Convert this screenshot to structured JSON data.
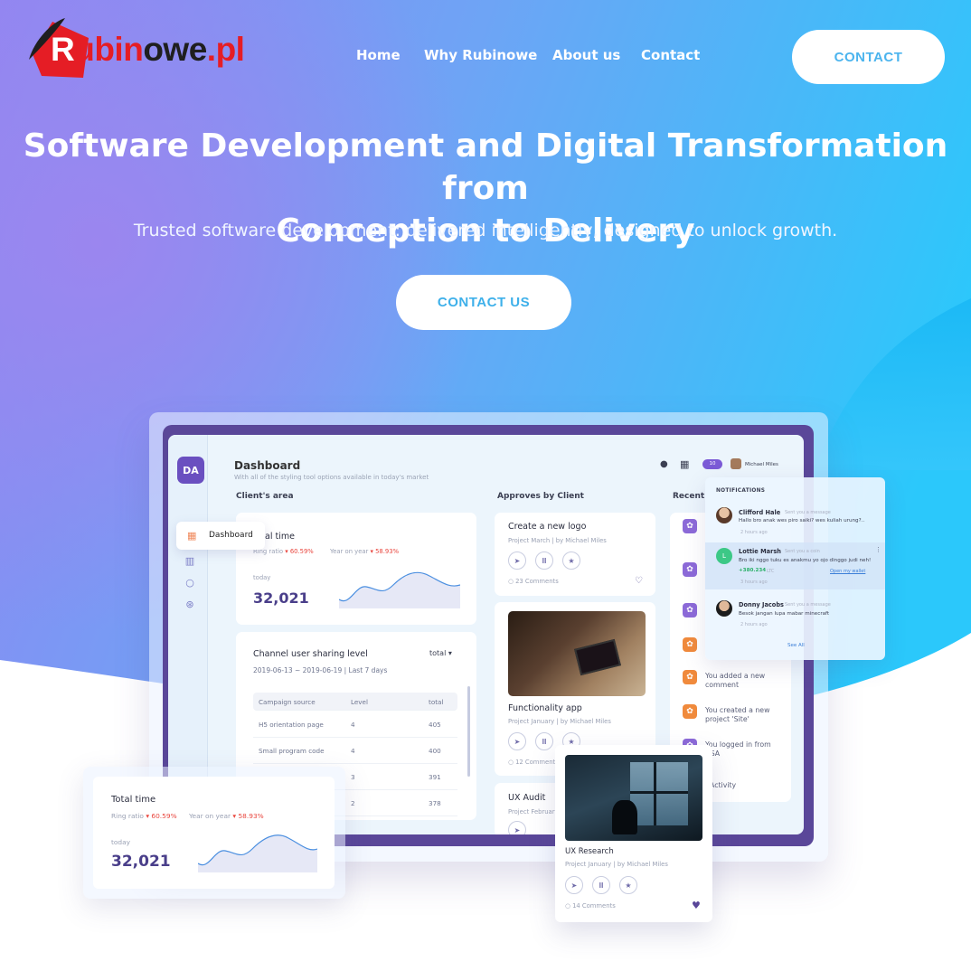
{
  "brand": {
    "logo_text_1": "R",
    "logo_text_2": "ubin",
    "logo_text_3": "owe",
    "logo_text_4": ".pl",
    "logo_word": "Rubinowe.pl",
    "colors": {
      "primary": "#e51d25",
      "accent_blue": "#3eb0ea",
      "purple": "#5a4799"
    }
  },
  "nav": {
    "links": [
      "Home",
      "Why Rubinowe",
      "About us",
      "Contact"
    ],
    "contact_button": "CONTACT"
  },
  "hero": {
    "title_line1": "Software Development and Digital Transformation from",
    "title_line2": "Conception to Delivery",
    "subtitle": "Trusted software development: delivered intelligently, designed to unlock growth.",
    "cta": "CONTACT US"
  },
  "dashboard": {
    "avatar": "DA",
    "title": "Dashboard",
    "subtitle": "With all of the styling tool options available in today's market",
    "user_name": "Michael Miles",
    "badge": "10",
    "sidebar_popup": "Dashboard",
    "sections": {
      "clients_area": "Client's area",
      "approves": "Approves by Client",
      "recent": "Recent"
    },
    "total_card": {
      "title_partial": "al time",
      "ring_ratio_label": "Ring ratio",
      "ring_ratio_value": "60.59%",
      "yoy_label": "Year on year",
      "yoy_value": "58.93%",
      "today_label": "today",
      "value": "32,021"
    },
    "channel": {
      "title": "Channel user sharing level",
      "filter": "total",
      "range": "2019-06-13 ~ 2019-06-19 | Last 7 days",
      "headers": [
        "Campaign source",
        "Level",
        "total"
      ],
      "rows": [
        [
          "H5 orientation page",
          "4",
          "405"
        ],
        [
          "Small program code",
          "4",
          "400"
        ],
        [
          "",
          "3",
          "391"
        ],
        [
          "",
          "2",
          "378"
        ]
      ]
    },
    "approves": [
      {
        "title": "Create a new logo",
        "meta_project": "Project March",
        "meta_by": "by Michael Miles",
        "comments": "23 Comments"
      },
      {
        "title": "Functionality app",
        "meta_project": "Project January",
        "meta_by": "by Michael Miles",
        "comments": "12 Comments"
      },
      {
        "title": "UX Audit",
        "meta_project": "Project February"
      }
    ],
    "recent": [
      {
        "text_line1": "You added a new",
        "text_line2": "comment",
        "color": "#f08a3c"
      },
      {
        "text_line1": "You created a new",
        "text_line2": "project 'Site'",
        "color": "#f08a3c"
      },
      {
        "text_line1": "You logged in from",
        "text_line2": "USA",
        "color": "#8c6ad8"
      }
    ],
    "recent_footer": "Activity"
  },
  "notifications": {
    "header": "NOTIFICATIONS",
    "items": [
      {
        "name": "Clifford Hale",
        "meta": "Sent you a message",
        "msg": "Hallo bro anak wes piro saiki? wes kuliah urung?..",
        "time": "2 hours ago"
      },
      {
        "name": "Lottie Marsh",
        "meta": "Sent you a coin",
        "msg": "Bro iki nggo tuku es anakmu yo ojo dinggo judi neh!",
        "amount": "+380.234",
        "unit": "LTC",
        "link": "Open my wallet",
        "time": "3 hours ago",
        "initial": "L"
      },
      {
        "name": "Donny Jacobs",
        "meta": "Sent you a message",
        "msg": "Besok jangan lupa mabar minecraft",
        "time": "2 hours ago"
      }
    ],
    "see_all": "See All"
  },
  "float_total": {
    "title": "Total time",
    "ring_ratio_label": "Ring ratio",
    "ring_ratio_value": "60.59%",
    "yoy_label": "Year on year",
    "yoy_value": "58.93%",
    "today_label": "today",
    "value": "32,021"
  },
  "float_ux": {
    "title": "UX Research",
    "meta_project": "Project January",
    "meta_by": "by Michael Miles",
    "comments": "14 Comments"
  }
}
